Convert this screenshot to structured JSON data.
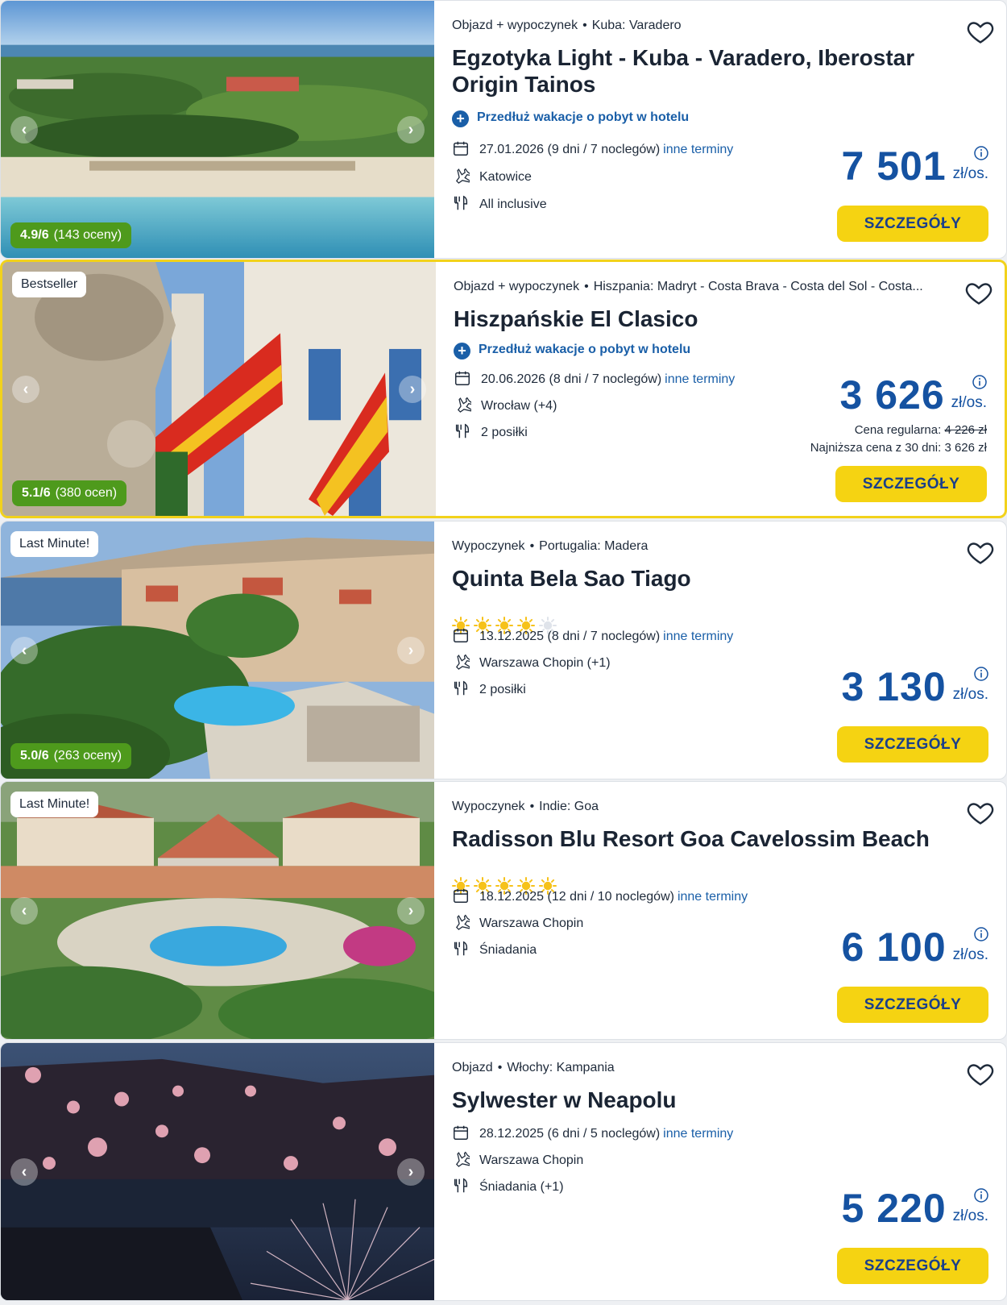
{
  "common": {
    "details_label": "SZCZEGÓŁY",
    "extend_label": "Przedłuż wakacje o pobyt w hotelu",
    "other_dates_label": "inne terminy",
    "unit_label": "zł/os."
  },
  "offers": [
    {
      "category": "Objazd + wypoczynek",
      "location": "Kuba: Varadero",
      "title": "Egzotyka Light - Kuba - Varadero, Iberostar Origin Tainos",
      "extend": true,
      "date": "27.01.2026 (9 dni / 7 noclegów)",
      "departure": "Katowice",
      "board": "All inclusive",
      "price": "7 501",
      "rating_score": "4.9/6",
      "rating_count": "(143 oceny)",
      "stars": 0
    },
    {
      "category": "Objazd + wypoczynek",
      "location": "Hiszpania: Madryt - Costa Brava - Costa del Sol - Costa...",
      "title": "Hiszpańskie El Clasico",
      "extend": true,
      "badge": "Bestseller",
      "date": "20.06.2026 (8 dni / 7 noclegów)",
      "departure": "Wrocław (+4)",
      "board": "2 posiłki",
      "price": "3 626",
      "regular_price_label": "Cena regularna:",
      "regular_price": "4 226 zł",
      "lowest_price_label": "Najniższa cena z 30 dni:",
      "lowest_price": "3 626 zł",
      "rating_score": "5.1/6",
      "rating_count": "(380 ocen)",
      "stars": 0
    },
    {
      "category": "Wypoczynek",
      "location": "Portugalia: Madera",
      "title": "Quinta Bela Sao Tiago",
      "badge": "Last Minute!",
      "stars": 4,
      "date": "13.12.2025 (8 dni / 7 noclegów)",
      "departure": "Warszawa Chopin (+1)",
      "board": "2 posiłki",
      "price": "3 130",
      "rating_score": "5.0/6",
      "rating_count": "(263 oceny)"
    },
    {
      "category": "Wypoczynek",
      "location": "Indie: Goa",
      "title": "Radisson Blu Resort Goa Cavelossim Beach",
      "badge": "Last Minute!",
      "stars": 5,
      "date": "18.12.2025 (12 dni / 10 noclegów)",
      "departure": "Warszawa Chopin",
      "board": "Śniadania",
      "price": "6 100"
    },
    {
      "category": "Objazd",
      "location": "Włochy: Kampania",
      "title": "Sylwester w Neapolu",
      "stars": 0,
      "date": "28.12.2025 (6 dni / 5 noclegów)",
      "departure": "Warszawa Chopin",
      "board": "Śniadania (+1)",
      "price": "5 220"
    }
  ],
  "icons": {
    "favorite": "heart-icon",
    "extend": "plus-circle-icon",
    "date": "calendar-icon",
    "departure": "plane-icon",
    "board": "fork-knife-icon",
    "price_info": "info-icon",
    "star_filled": "sun-star-icon",
    "star_empty": "sun-star-empty-icon"
  },
  "colors": {
    "accent_blue": "#1552a1",
    "button_yellow": "#f5d312",
    "rating_green": "#4e9a1c",
    "featured_border": "#f2d21b",
    "star_yellow": "#f6c21a"
  }
}
